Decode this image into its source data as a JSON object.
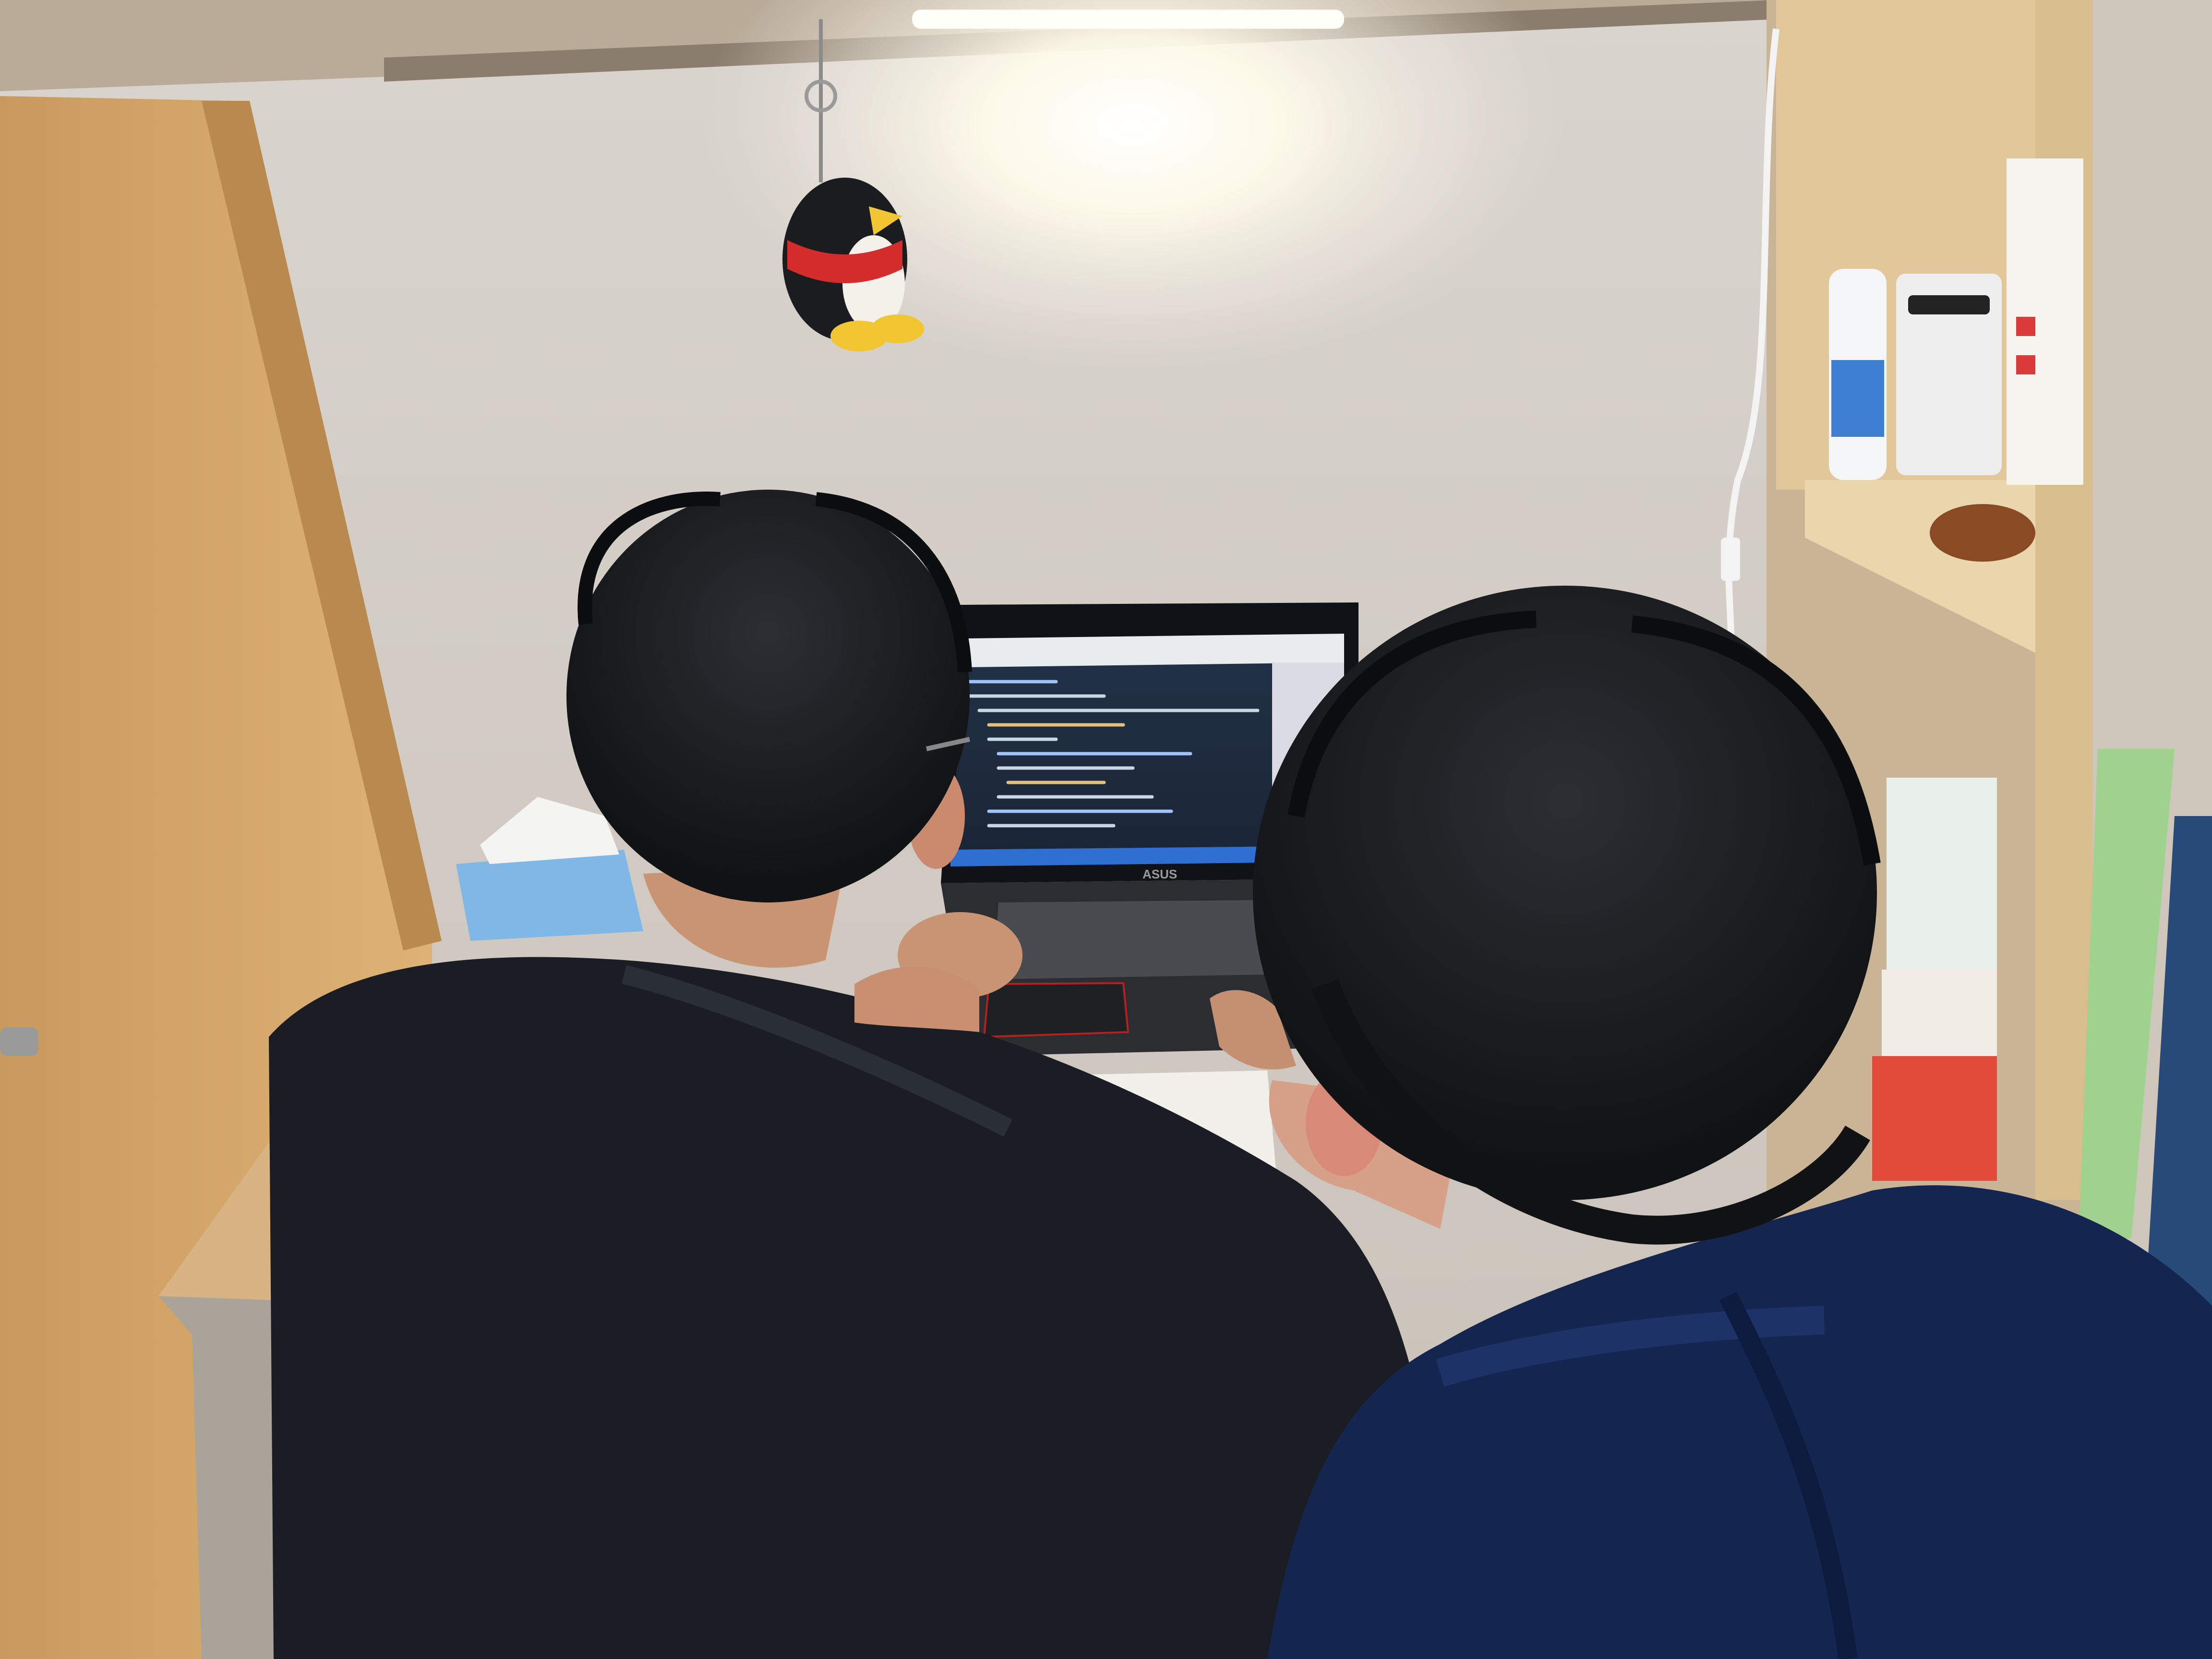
{
  "scene": {
    "description_type": "photo",
    "laptop": {
      "brand": "ASUS",
      "screen_app": "code-editor",
      "theme": "dark"
    },
    "colors": {
      "wall": "#d6d0ca",
      "wardrobe": "#d7a86a",
      "shelf": "#e6cfa4",
      "screen_bg": "#1e2a3a",
      "lamp": "#fffdf2",
      "shirt_left": "#1a1d24",
      "hoodie_right": "#142650",
      "hair": "#16181b",
      "penguin_scarf": "#d42b2b"
    }
  }
}
